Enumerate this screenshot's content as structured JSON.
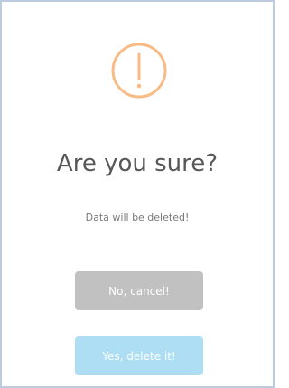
{
  "dialog": {
    "icon": "warning-exclamation-icon",
    "title": "Are you sure?",
    "message": "Data will be deleted!",
    "cancel_label": "No, cancel!",
    "confirm_label": "Yes, delete it!"
  },
  "colors": {
    "warning": "#f8bb86",
    "title_text": "#575757",
    "message_text": "#797979",
    "cancel_button": "#c1c1c1",
    "confirm_button": "#aedef4",
    "border": "#bccbde"
  }
}
